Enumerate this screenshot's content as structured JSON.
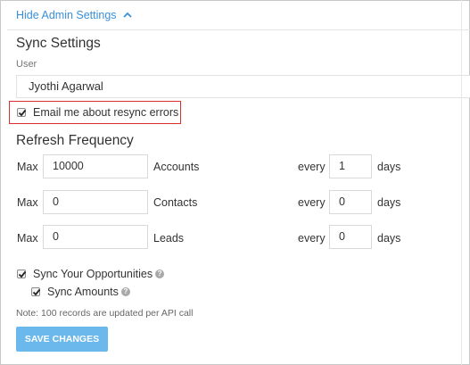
{
  "toggle": {
    "label": "Hide Admin Settings"
  },
  "sync": {
    "title": "Sync Settings",
    "user_label": "User",
    "user_value": "Jyothi Agarwal",
    "email_errors": {
      "label": "Email me about resync errors",
      "checked": true
    }
  },
  "refresh": {
    "title": "Refresh Frequency",
    "rows": [
      {
        "max_label": "Max",
        "max_value": "10000",
        "object": "Accounts",
        "every_label": "every",
        "every_value": "1",
        "unit": "days"
      },
      {
        "max_label": "Max",
        "max_value": "0",
        "object": "Contacts",
        "every_label": "every",
        "every_value": "0",
        "unit": "days"
      },
      {
        "max_label": "Max",
        "max_value": "0",
        "object": "Leads",
        "every_label": "every",
        "every_value": "0",
        "unit": "days"
      }
    ]
  },
  "options": {
    "sync_opportunities": {
      "label": "Sync Your Opportunities",
      "checked": true
    },
    "sync_amounts": {
      "label": "Sync Amounts",
      "checked": true
    }
  },
  "note": "Note: 100 records are updated per API call",
  "save_button": {
    "label": "SAVE CHANGES"
  },
  "colors": {
    "link": "#3a8fd8",
    "highlight_border": "#d9302c",
    "button_bg": "#6bb8ec"
  },
  "icons": {
    "toggle": "chevron-up-icon",
    "checkbox": "checkmark-icon",
    "help": "question-circle-icon"
  }
}
